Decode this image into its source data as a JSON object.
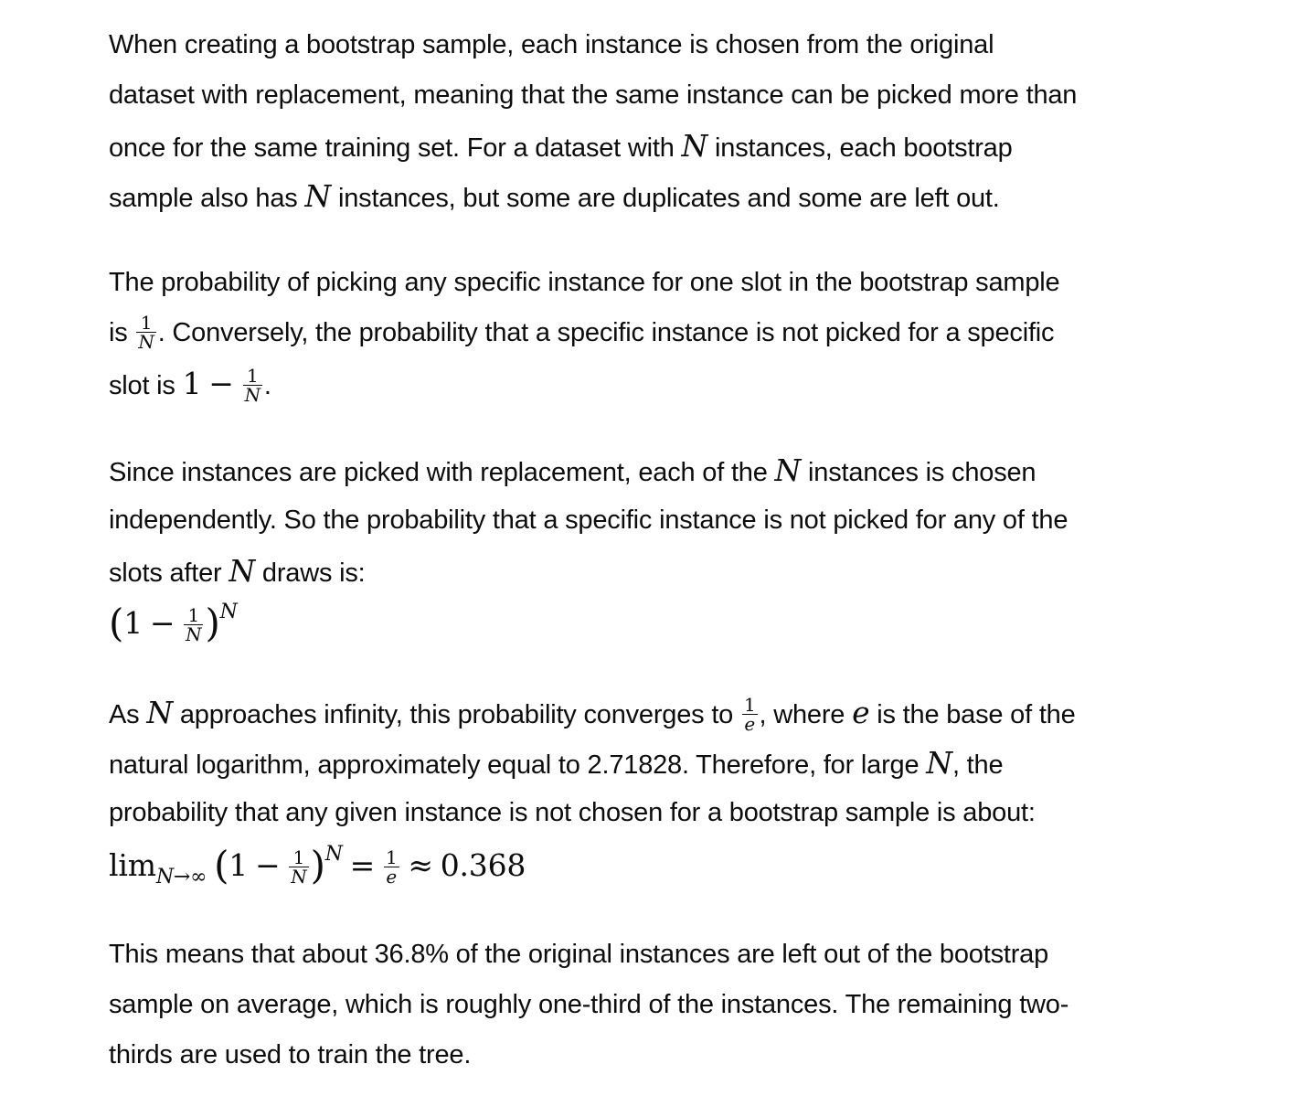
{
  "paragraphs": {
    "p1": {
      "l1": "When creating a bootstrap sample, each instance is chosen from the original",
      "l2": "dataset with replacement, meaning that the same instance can be picked more than",
      "l3a": "once for the same training set. For a dataset with ",
      "l3b": " instances, each bootstrap",
      "l4a": "sample also has ",
      "l4b": " instances, but some are duplicates and some are left out."
    },
    "p2": {
      "l1": "The probability of picking any specific instance for one slot in the bootstrap sample",
      "l2a": "is ",
      "l2b": ". Conversely, the probability that a specific instance is not picked for a specific",
      "l3a": "slot is ",
      "l3b": "."
    },
    "p3": {
      "l1a": "Since instances are picked with replacement, each of the ",
      "l1b": " instances is chosen",
      "l2": "independently. So the probability that a specific instance is not picked for any of the",
      "l3a": "slots after ",
      "l3b": " draws is:"
    },
    "p4": {
      "l1a": "As ",
      "l1b": " approaches infinity, this probability converges to ",
      "l1c": ", where ",
      "l1d": " is the base of the",
      "l2a": "natural logarithm, approximately equal to 2.71828. Therefore, for large ",
      "l2b": ", the",
      "l3": "probability that any given instance is not chosen for a bootstrap sample is about:"
    },
    "p5": {
      "l1": "This means that about 36.8% of the original instances are left out of the bootstrap",
      "l2": "sample on average, which is roughly one-third of the instances. The remaining two-",
      "l3": "thirds are used to train the tree."
    }
  },
  "math": {
    "N": "N",
    "e": "e",
    "one": "1",
    "minus": "−",
    "lparen": "(",
    "rparen": ")",
    "lim": "lim",
    "lim_sub": "N→∞",
    "equals": "=",
    "approx": "≈",
    "result": "0.368"
  }
}
